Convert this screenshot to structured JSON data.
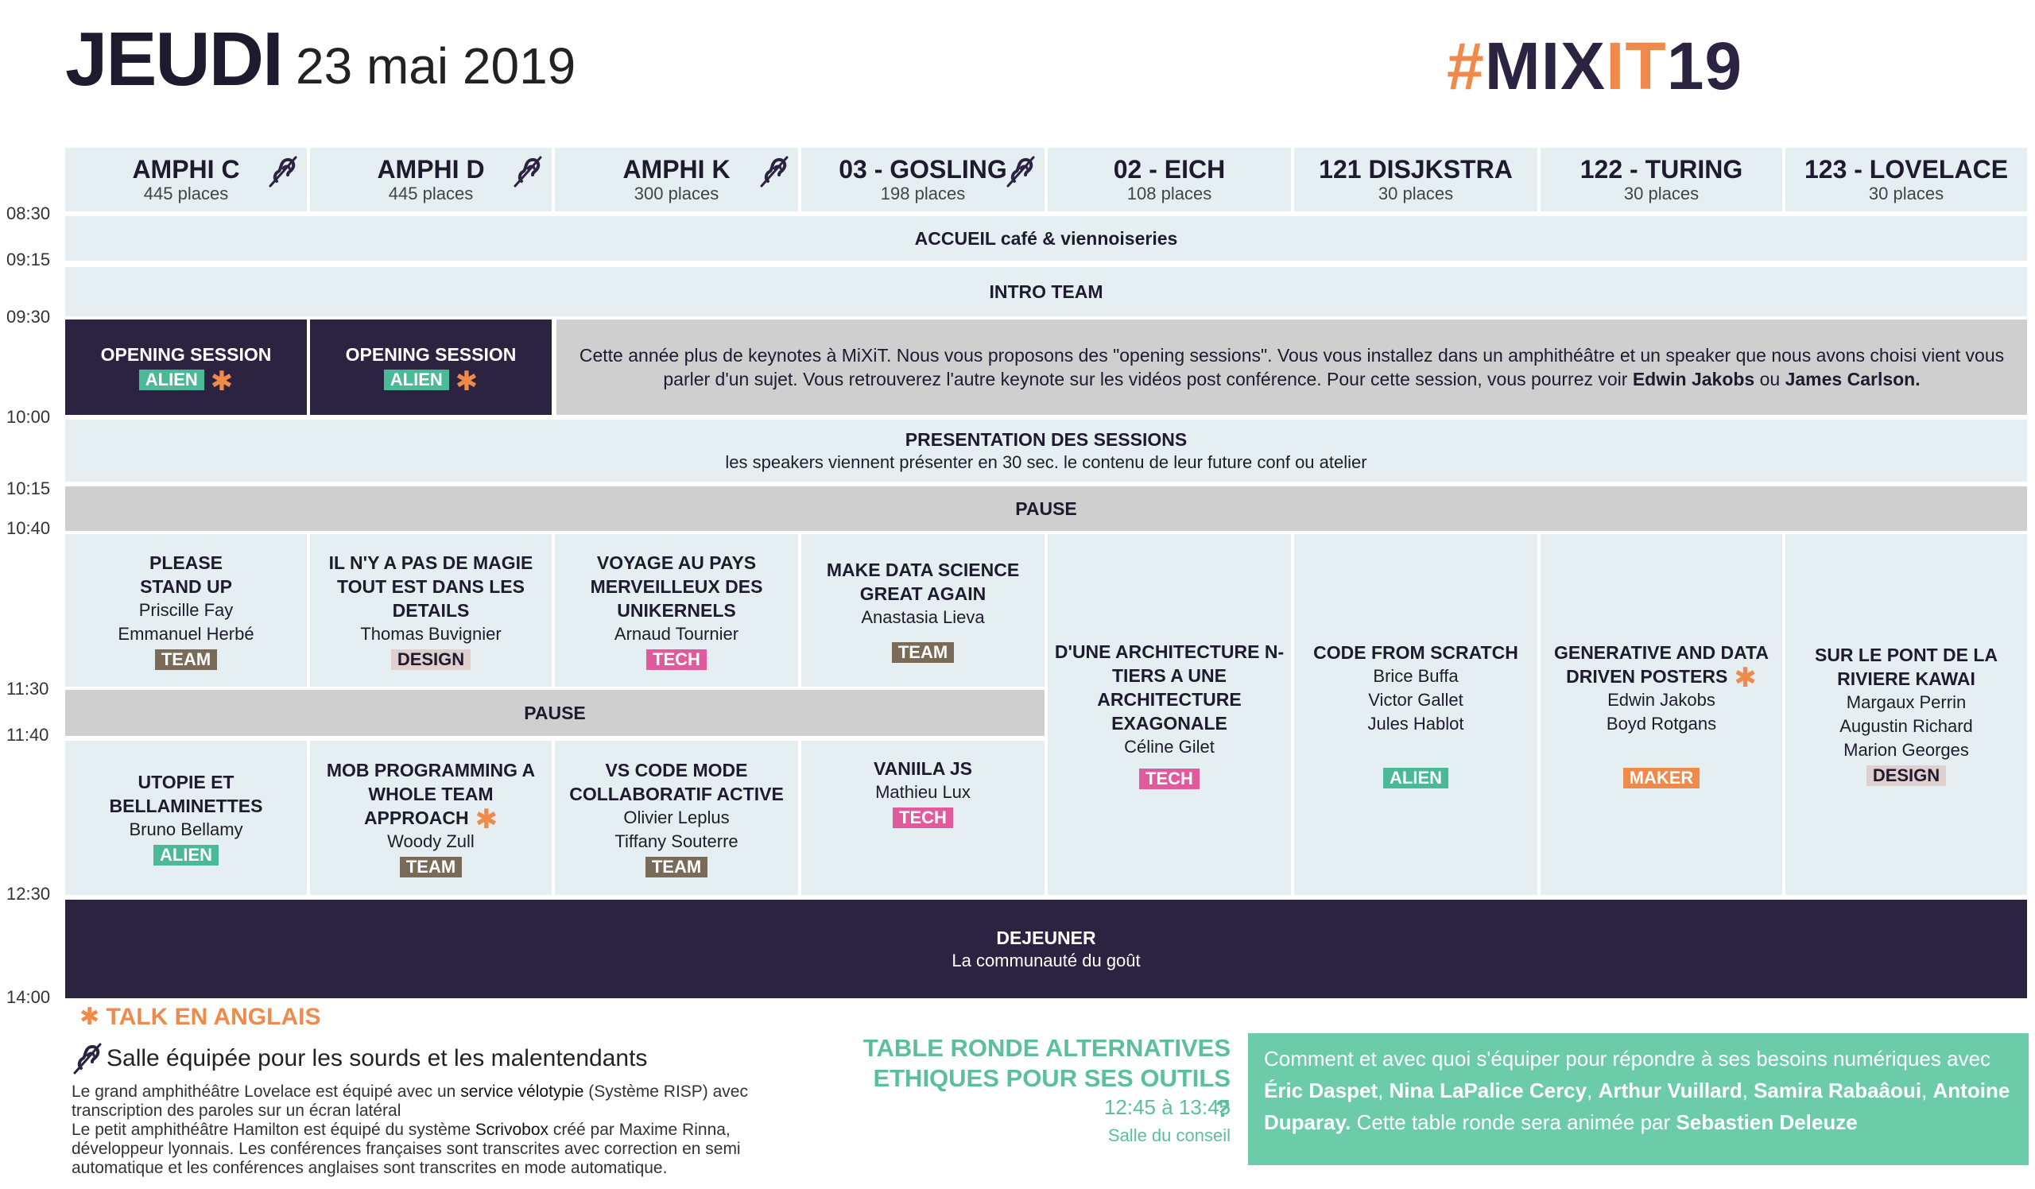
{
  "header": {
    "day": "JEUDI",
    "date": "23 mai 2019",
    "logo_hash": "#",
    "logo_mix": "MIX",
    "logo_it": "IT",
    "logo_year": "19"
  },
  "colors": {
    "dark": "#2b2340",
    "cell": "#e5eef0",
    "grey": "#cfcfcf",
    "orange": "#f08a4b",
    "green": "#6cccaa",
    "tag_team": "#7a6a58",
    "tag_tech": "#e05a9c",
    "tag_alien": "#49b997",
    "tag_design": "#e0cfcf",
    "tag_maker": "#f08a4b"
  },
  "rooms": [
    {
      "name": "AMPHI C",
      "capacity": "445 places",
      "accessible": true
    },
    {
      "name": "AMPHI D",
      "capacity": "445 places",
      "accessible": true
    },
    {
      "name": "AMPHI K",
      "capacity": "300 places",
      "accessible": true
    },
    {
      "name": "03 - GOSLING",
      "capacity": "198 places",
      "accessible": true
    },
    {
      "name": "02 - EICH",
      "capacity": "108 places",
      "accessible": false
    },
    {
      "name": "121 DISJKSTRA",
      "capacity": "30 places",
      "accessible": false
    },
    {
      "name": "122 - TURING",
      "capacity": "30 places",
      "accessible": false
    },
    {
      "name": "123 - LOVELACE",
      "capacity": "30 places",
      "accessible": false
    }
  ],
  "times": [
    "08:30",
    "09:15",
    "09:30",
    "10:00",
    "10:15",
    "10:40",
    "11:30",
    "11:40",
    "12:30",
    "14:00"
  ],
  "rows": {
    "accueil": "ACCUEIL café & viennoiseries",
    "intro": "INTRO TEAM",
    "opening_label": "OPENING SESSION",
    "opening_tag": "ALIEN",
    "keynote_text": "Cette année plus de keynotes à MiXiT. Nous vous proposons des \"opening sessions\". Vous vous installez dans un amphithéâtre et un speaker que nous avons choisi vient vous parler d'un sujet. Vous retrouverez l'autre keynote sur les vidéos post conférence. Pour cette session, vous pourrez voir",
    "keynote_speaker1": "Edwin Jakobs",
    "keynote_and": "ou",
    "keynote_speaker2": "James Carlson.",
    "presentation_title": "PRESENTATION DES SESSIONS",
    "presentation_sub": "les speakers viennent présenter en 30 sec. le contenu de leur future conf ou atelier",
    "pause1": "PAUSE",
    "pause2": "PAUSE",
    "lunch_title": "DEJEUNER",
    "lunch_sub": "La communauté du goût"
  },
  "talks_morning": [
    {
      "title": "PLEASE STAND UP",
      "speakers": [
        "Priscille Fay",
        "Emmanuel Herbé"
      ],
      "tag": "TEAM"
    },
    {
      "title": "IL N'Y A PAS DE MAGIE TOUT EST DANS LES DETAILS",
      "speakers": [
        "Thomas Buvignier"
      ],
      "tag": "DESIGN"
    },
    {
      "title": "VOYAGE AU PAYS MERVEILLEUX DES UNIKERNELS",
      "speakers": [
        "Arnaud Tournier"
      ],
      "tag": "TECH"
    },
    {
      "title": "MAKE DATA SCIENCE GREAT AGAIN",
      "speakers": [
        "Anastasia Lieva"
      ],
      "tag": "TEAM"
    }
  ],
  "talks_long": [
    {
      "title": "D'UNE ARCHITECTURE N-TIERS A UNE ARCHITECTURE EXAGONALE",
      "speakers": [
        "Céline Gilet"
      ],
      "tag": "TECH"
    },
    {
      "title": "CODE FROM SCRATCH",
      "speakers": [
        "Brice Buffa",
        "Victor Gallet",
        "Jules Hablot"
      ],
      "tag": "ALIEN"
    },
    {
      "title": "GENERATIVE AND DATA DRIVEN POSTERS",
      "speakers": [
        "Edwin Jakobs",
        "Boyd Rotgans"
      ],
      "tag": "MAKER",
      "english": true
    },
    {
      "title": "SUR LE PONT DE LA RIVIERE KAWAI",
      "speakers": [
        "Margaux Perrin",
        "Augustin Richard",
        "Marion Georges"
      ],
      "tag": "DESIGN"
    }
  ],
  "talks_late": [
    {
      "title": "UTOPIE ET BELLAMINETTES",
      "speakers": [
        "Bruno Bellamy"
      ],
      "tag": "ALIEN"
    },
    {
      "title": "MOB PROGRAMMING A WHOLE TEAM APPROACH",
      "speakers": [
        "Woody Zull"
      ],
      "tag": "TEAM",
      "english": true
    },
    {
      "title": "VS CODE MODE COLLABORATIF ACTIVE",
      "speakers": [
        "Olivier Leplus",
        "Tiffany Souterre"
      ],
      "tag": "TEAM"
    },
    {
      "title": "VANIILA JS",
      "speakers": [
        "Mathieu Lux"
      ],
      "tag": "TECH"
    }
  ],
  "legend": {
    "english_label": "TALK EN ANGLAIS",
    "hearing_label": "Salle équipée pour les sourds et les malentendants",
    "para1_a": "Le grand amphithéâtre Lovelace est équipé avec un",
    "para1_b": "service vélotypie",
    "para1_c": "(Système RISP) avec transcription des paroles sur un écran latéral",
    "para2_a": "Le petit amphithéâtre Hamilton est équipé du système",
    "para2_b": "Scrivobox",
    "para2_c": "créé par Maxime Rinna, développeur lyonnais. Les conférences françaises sont transcrites avec correction en semi automatique et les conférences anglaises sont transcrites en mode automatique."
  },
  "table_ronde": {
    "title": "TABLE RONDE ALTERNATIVES ETHIQUES POUR SES OUTILS ?",
    "time": "12:45 à 13:45",
    "room": "Salle du conseil",
    "intro": "Comment et avec quoi s'équiper pour répondre à ses besoins numériques avec",
    "people": [
      "Éric Daspet",
      "Nina LaPalice Cercy",
      "Arthur Vuillard",
      "Samira Rabaâoui",
      "Antoine Duparay."
    ],
    "outro": "Cette table ronde sera animée par",
    "moderator": "Sebastien Deleuze"
  }
}
